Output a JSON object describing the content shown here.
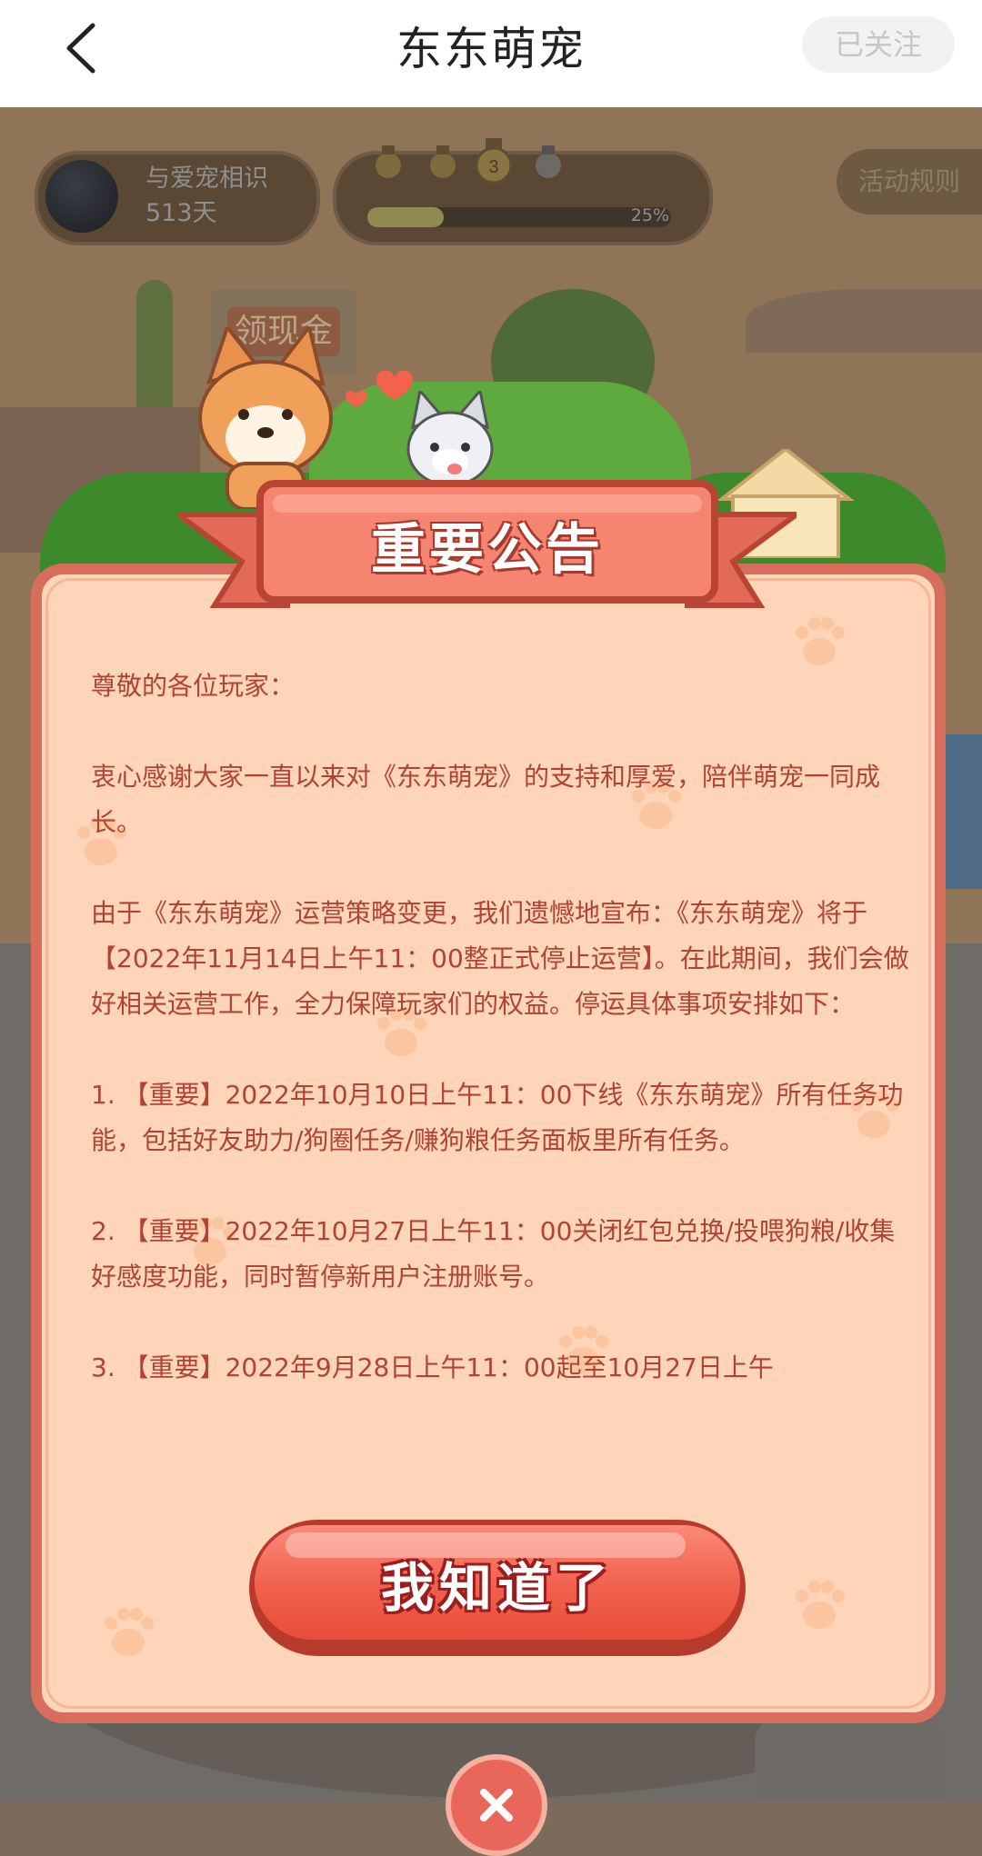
{
  "header": {
    "title": "东东萌宠",
    "follow_label": "已关注"
  },
  "game": {
    "user_days_text": "与爱宠相识513天",
    "level": "3",
    "progress_percent": 25,
    "progress_label": "25%",
    "rules_label": "活动规则",
    "cash_sign_label": "领现金"
  },
  "modal": {
    "title": "重要公告",
    "body": "尊敬的各位玩家：\n\n衷心感谢大家一直以来对《东东萌宠》的支持和厚爱，陪伴萌宠一同成长。\n\n由于《东东萌宠》运营策略变更，我们遗憾地宣布：《东东萌宠》将于【2022年11月14日上午11：00整正式停止运营】。在此期间，我们会做好相关运营工作，全力保障玩家们的权益。停运具体事项安排如下：\n\n1. 【重要】2022年10月10日上午11：00下线《东东萌宠》所有任务功能，包括好友助力/狗圈任务/赚狗粮任务面板里所有任务。\n\n2. 【重要】2022年10月27日上午11：00关闭红包兑换/投喂狗粮/收集好感度功能，同时暂停新用户注册账号。\n\n3. 【重要】2022年9月28日上午11：00起至10月27日上午",
    "ok_label": "我知道了"
  },
  "colors": {
    "modal_bg": "#fed5b8",
    "modal_border": "#d76e5d",
    "body_text": "#b04434",
    "button": "#f0604c"
  }
}
